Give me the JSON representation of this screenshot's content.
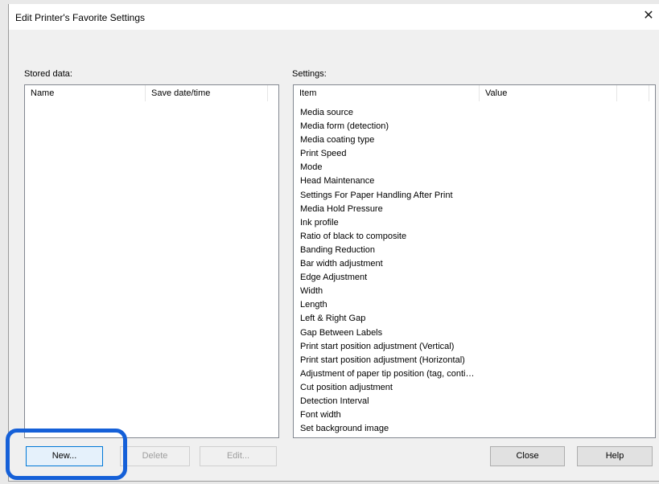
{
  "window": {
    "title": "Edit Printer's Favorite Settings",
    "close_glyph": "✕"
  },
  "stored_data": {
    "label": "Stored data:",
    "columns": [
      "Name",
      "Save date/time"
    ]
  },
  "settings": {
    "label": "Settings:",
    "columns": [
      "Item",
      "Value"
    ],
    "items": [
      "Media source",
      "Media form (detection)",
      "Media coating type",
      "Print Speed",
      "Mode",
      "Head Maintenance",
      "Settings For Paper Handling After Print",
      "Media Hold Pressure",
      "Ink profile",
      "Ratio of black to composite",
      "Banding Reduction",
      "Bar width adjustment",
      "Edge Adjustment",
      "Width",
      "Length",
      "Left & Right Gap",
      "Gap Between Labels",
      "Print start position adjustment (Vertical)",
      "Print start position adjustment (Horizontal)",
      "Adjustment of paper tip position (tag, conti…",
      "Cut position adjustment",
      "Detection Interval",
      "Font width",
      "Set background image"
    ]
  },
  "buttons": {
    "new": "New...",
    "delete": "Delete",
    "edit": "Edit...",
    "close": "Close",
    "help": "Help"
  },
  "colors": {
    "highlight_ring": "#1560d8"
  }
}
